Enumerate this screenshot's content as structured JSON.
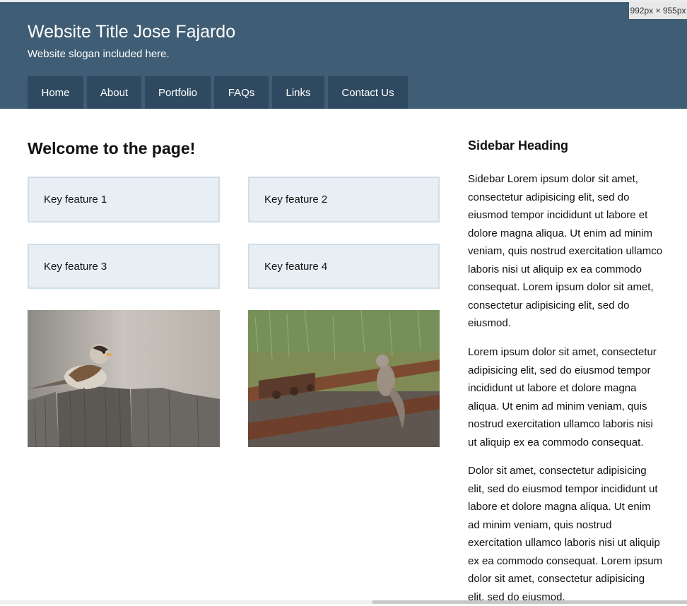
{
  "badge": "992px × 955px",
  "header": {
    "title": "Website Title Jose Fajardo",
    "slogan": "Website slogan included here.",
    "nav": [
      {
        "label": "Home"
      },
      {
        "label": "About"
      },
      {
        "label": "Portfolio"
      },
      {
        "label": "FAQs"
      },
      {
        "label": "Links"
      },
      {
        "label": "Contact Us"
      }
    ]
  },
  "main": {
    "heading": "Welcome to the page!",
    "features": [
      "Key feature 1",
      "Key feature 2",
      "Key feature 3",
      "Key feature 4"
    ],
    "images": [
      "sparrow-on-fence",
      "squirrel-on-railroad-track"
    ]
  },
  "sidebar": {
    "heading": "Sidebar Heading",
    "paragraphs": [
      "Sidebar Lorem ipsum dolor sit amet, consectetur adipisicing elit, sed do eiusmod tempor incididunt ut labore et dolore magna aliqua. Ut enim ad minim veniam, quis nostrud exercitation ullamco laboris nisi ut aliquip ex ea commodo consequat. Lorem ipsum dolor sit amet, consectetur adipisicing elit, sed do eiusmod.",
      "Lorem ipsum dolor sit amet, consectetur adipisicing elit, sed do eiusmod tempor incididunt ut labore et dolore magna aliqua. Ut enim ad minim veniam, quis nostrud exercitation ullamco laboris nisi ut aliquip ex ea commodo consequat.",
      "Dolor sit amet, consectetur adipisicing elit, sed do eiusmod tempor incididunt ut labore et dolore magna aliqua. Ut enim ad minim veniam, quis nostrud exercitation ullamco laboris nisi ut aliquip ex ea commodo consequat. Lorem ipsum dolor sit amet, consectetur adipisicing elit, sed do eiusmod."
    ]
  },
  "colors": {
    "header_bg": "#3f5d74",
    "nav_bg": "#2f4a60",
    "feature_bg": "#e7eef4",
    "feature_border": "#d0dde7"
  }
}
